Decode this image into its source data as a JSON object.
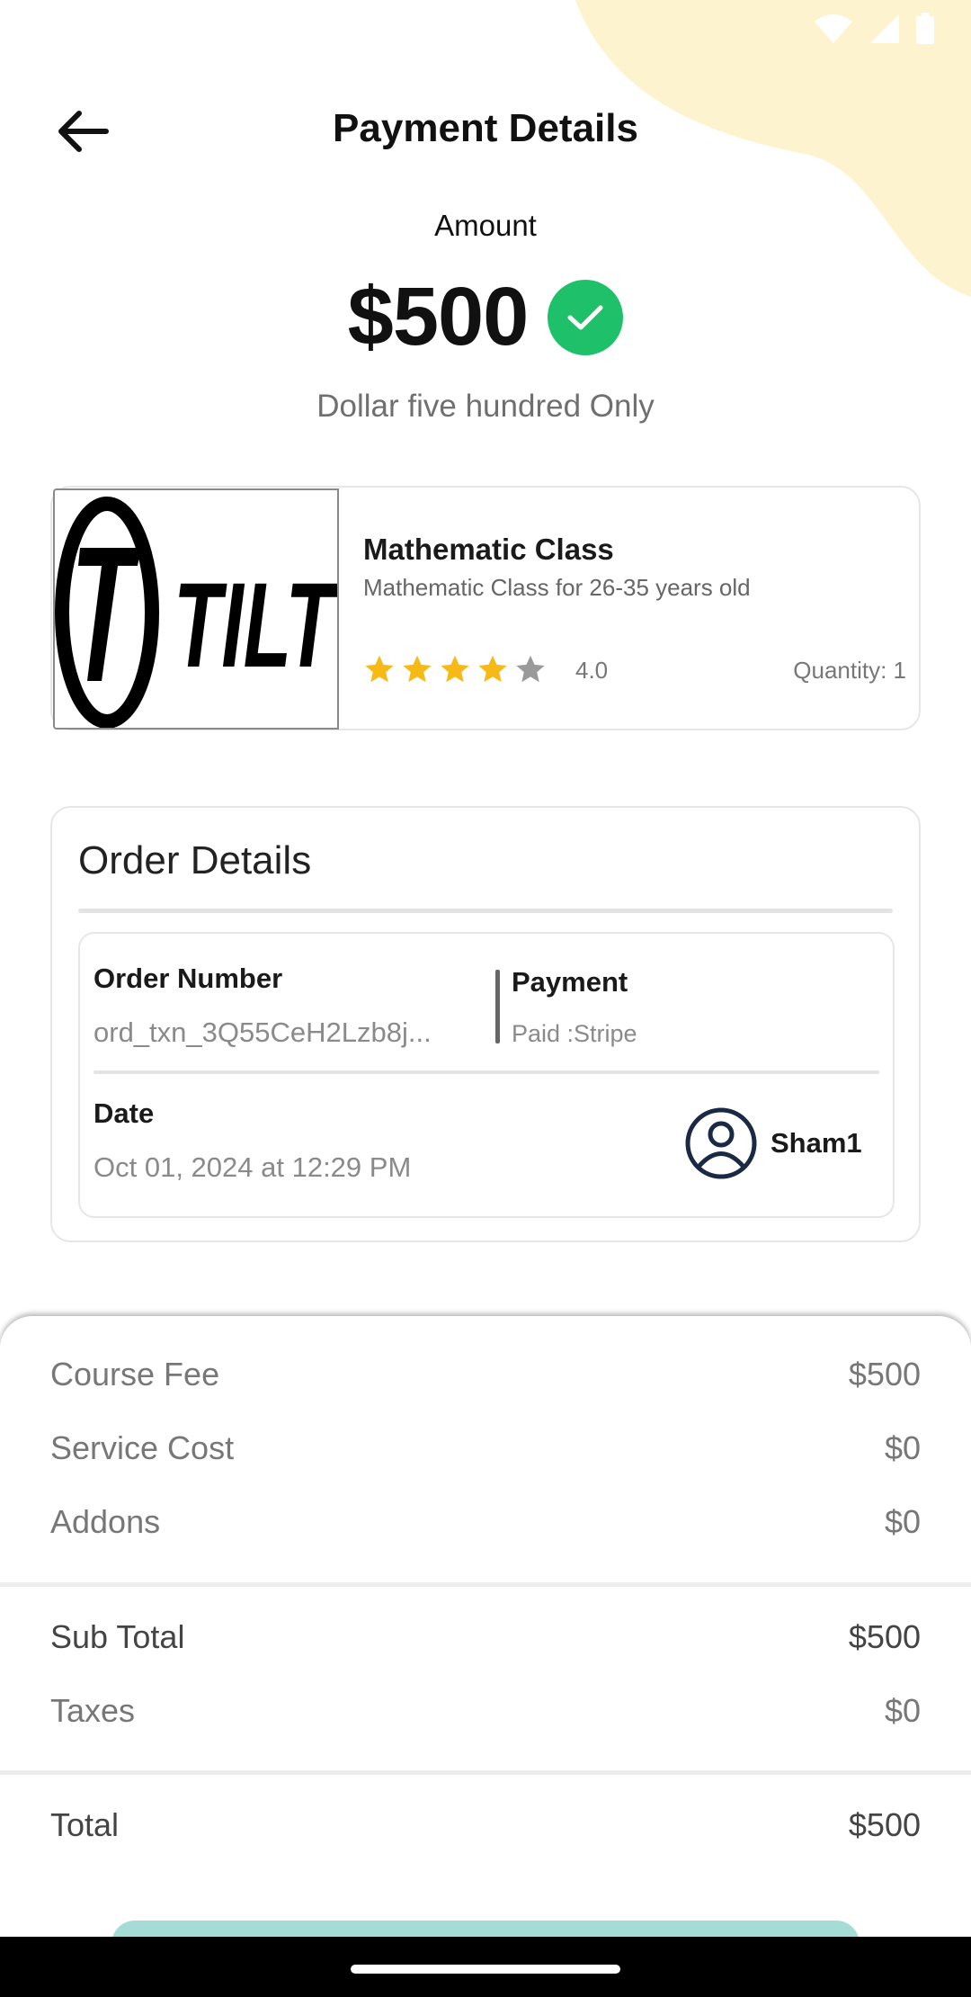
{
  "header": {
    "title": "Payment Details"
  },
  "amount": {
    "label": "Amount",
    "value": "$500",
    "in_words": "Dollar five hundred Only",
    "status_color": "#1ec069"
  },
  "product": {
    "logo_text": "TILT",
    "title": "Mathematic Class",
    "description": "Mathematic Class for 26-35 years old",
    "rating": 4.0,
    "rating_text": "4.0",
    "stars_filled": 4,
    "stars_total": 5,
    "quantity": "Quantity: 1"
  },
  "order": {
    "title": "Order Details",
    "order_number_label": "Order Number",
    "order_number_value": "ord_txn_3Q55CeH2Lzb8j...",
    "payment_label": "Payment",
    "payment_value": "Paid :Stripe",
    "date_label": "Date",
    "date_value": "Oct 01, 2024 at 12:29 PM",
    "user_name": "Sham1"
  },
  "summary": {
    "course_fee_label": "Course Fee",
    "course_fee_value": "$500",
    "service_cost_label": "Service Cost",
    "service_cost_value": "$0",
    "addons_label": "Addons",
    "addons_value": "$0",
    "subtotal_label": "Sub Total",
    "subtotal_value": "$500",
    "taxes_label": "Taxes",
    "taxes_value": "$0",
    "total_label": "Total",
    "total_value": "$500"
  },
  "colors": {
    "accent_blob": "#fdf4cf",
    "star_filled": "#f7b916",
    "star_empty": "#9a9a9a",
    "button_hint": "#a5dcd5"
  }
}
